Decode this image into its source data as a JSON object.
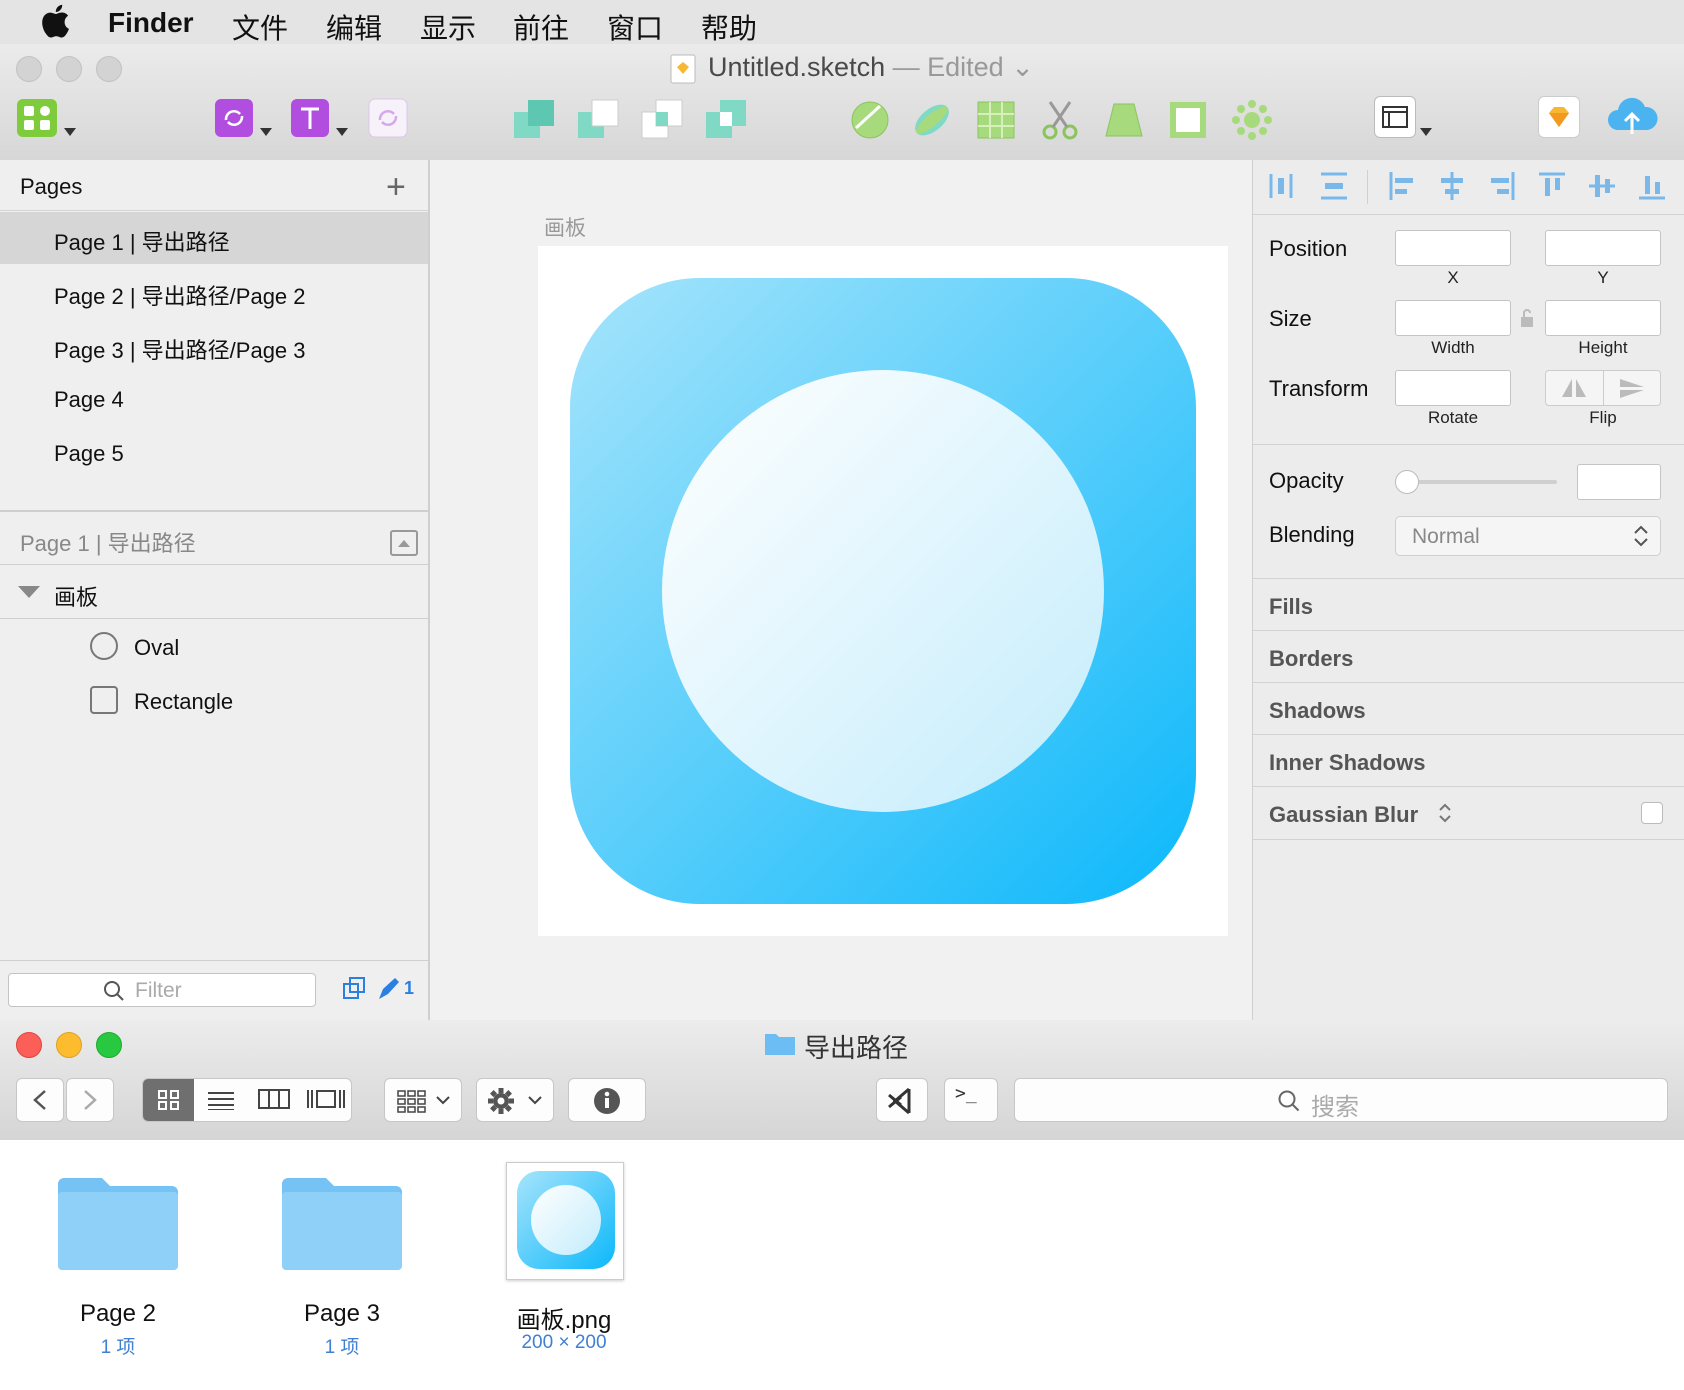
{
  "menubar": {
    "app": "Finder",
    "items": [
      "文件",
      "编辑",
      "显示",
      "前往",
      "窗口",
      "帮助"
    ]
  },
  "sketch": {
    "title": "Untitled.sketch",
    "title_status": "— Edited",
    "pages_header": "Pages",
    "pages": [
      "Page 1 | 导出路径",
      "Page 2 | 导出路径/Page 2",
      "Page 3 | 导出路径/Page 3",
      "Page 4",
      "Page 5"
    ],
    "layers_header": "Page 1 | 导出路径",
    "artboard_layer": "画板",
    "layers": [
      "Oval",
      "Rectangle"
    ],
    "filter_placeholder": "Filter",
    "badge_count": "1",
    "artboard_label": "画板",
    "inspector": {
      "position": "Position",
      "x": "X",
      "y": "Y",
      "size": "Size",
      "width": "Width",
      "height": "Height",
      "transform": "Transform",
      "rotate": "Rotate",
      "flip": "Flip",
      "opacity": "Opacity",
      "blending": "Blending",
      "blending_value": "Normal",
      "sections": [
        "Fills",
        "Borders",
        "Shadows",
        "Inner Shadows",
        "Gaussian Blur"
      ]
    },
    "colors": {
      "icon_gradient_start": "#a6e4fb",
      "icon_gradient_end": "#0cb8fb",
      "accent_purple": "#b14ee0",
      "accent_green": "#7ecb3b"
    }
  },
  "finder": {
    "title": "导出路径",
    "search_placeholder": "搜索",
    "files": [
      {
        "name": "Page 2",
        "sub": "1 项"
      },
      {
        "name": "Page 3",
        "sub": "1 项"
      },
      {
        "name": "画板.png",
        "sub": "200 × 200"
      }
    ]
  }
}
